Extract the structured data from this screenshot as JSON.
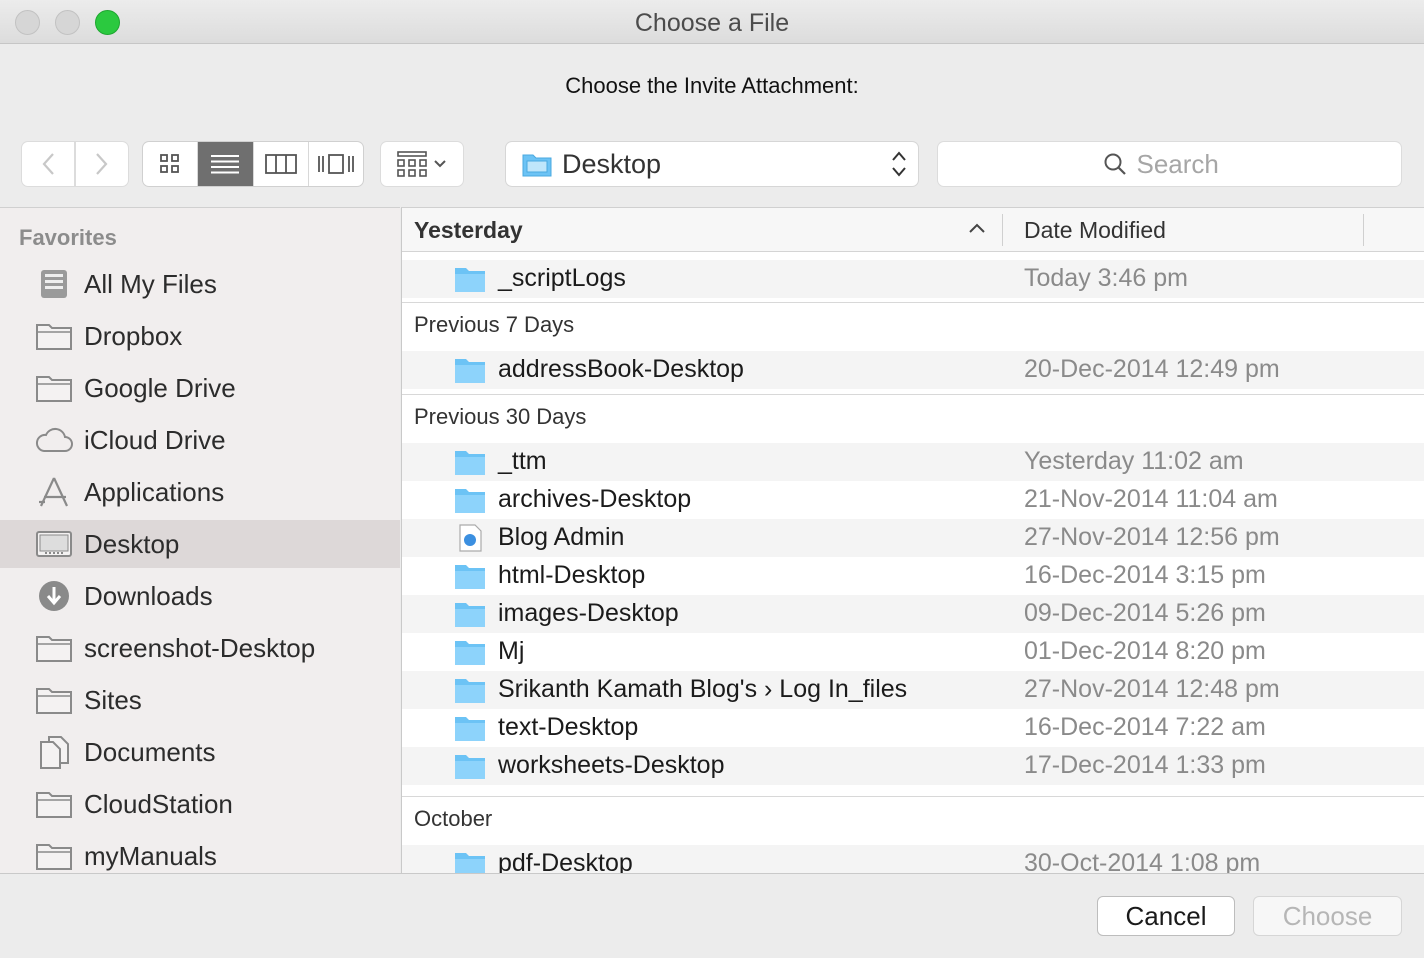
{
  "window": {
    "title": "Choose a File",
    "prompt": "Choose the Invite Attachment:"
  },
  "toolbar": {
    "location": "Desktop",
    "search_placeholder": "Search",
    "view_modes": [
      "icon-view",
      "list-view",
      "column-view",
      "cover-flow-view"
    ],
    "active_view": "list-view"
  },
  "sidebar": {
    "heading": "Favorites",
    "items": [
      {
        "label": "All My Files",
        "icon": "all-files-icon"
      },
      {
        "label": "Dropbox",
        "icon": "folder-icon"
      },
      {
        "label": "Google Drive",
        "icon": "folder-icon"
      },
      {
        "label": "iCloud Drive",
        "icon": "cloud-icon"
      },
      {
        "label": "Applications",
        "icon": "applications-icon"
      },
      {
        "label": "Desktop",
        "icon": "desktop-icon",
        "selected": true
      },
      {
        "label": "Downloads",
        "icon": "downloads-icon"
      },
      {
        "label": "screenshot-Desktop",
        "icon": "folder-icon"
      },
      {
        "label": "Sites",
        "icon": "folder-icon"
      },
      {
        "label": "Documents",
        "icon": "documents-icon"
      },
      {
        "label": "CloudStation",
        "icon": "folder-icon"
      },
      {
        "label": "myManuals",
        "icon": "folder-icon"
      }
    ]
  },
  "columns": {
    "name": "Yesterday",
    "date": "Date Modified"
  },
  "groups": [
    {
      "label": "Previous 7 Days"
    },
    {
      "label": "Previous 30 Days"
    },
    {
      "label": "October"
    }
  ],
  "files": [
    {
      "name": "_scriptLogs",
      "date": "Today 3:46 pm",
      "icon": "folder-icon"
    },
    {
      "name": "addressBook-Desktop",
      "date": "20-Dec-2014 12:49 pm",
      "icon": "folder-icon"
    },
    {
      "name": "_ttm",
      "date": "Yesterday 11:02 am",
      "icon": "folder-icon"
    },
    {
      "name": "archives-Desktop",
      "date": "21-Nov-2014 11:04 am",
      "icon": "folder-icon"
    },
    {
      "name": "Blog Admin",
      "date": "27-Nov-2014 12:56 pm",
      "icon": "safari-document-icon"
    },
    {
      "name": "html-Desktop",
      "date": "16-Dec-2014 3:15 pm",
      "icon": "folder-icon"
    },
    {
      "name": "images-Desktop",
      "date": "09-Dec-2014 5:26 pm",
      "icon": "folder-icon"
    },
    {
      "name": "Mj",
      "date": "01-Dec-2014 8:20 pm",
      "icon": "folder-icon"
    },
    {
      "name": "Srikanth Kamath Blog's › Log In_files",
      "date": "27-Nov-2014 12:48 pm",
      "icon": "folder-icon"
    },
    {
      "name": "text-Desktop",
      "date": "16-Dec-2014 7:22 am",
      "icon": "folder-icon"
    },
    {
      "name": "worksheets-Desktop",
      "date": "17-Dec-2014 1:33 pm",
      "icon": "folder-icon"
    },
    {
      "name": "pdf-Desktop",
      "date": "30-Oct-2014 1:08 pm",
      "icon": "folder-icon"
    }
  ],
  "buttons": {
    "cancel": "Cancel",
    "choose": "Choose"
  },
  "colors": {
    "folder_blue": "#6cc3f5",
    "zoom_green": "#2bc93f",
    "selection_gray": "#ddd8d8"
  }
}
